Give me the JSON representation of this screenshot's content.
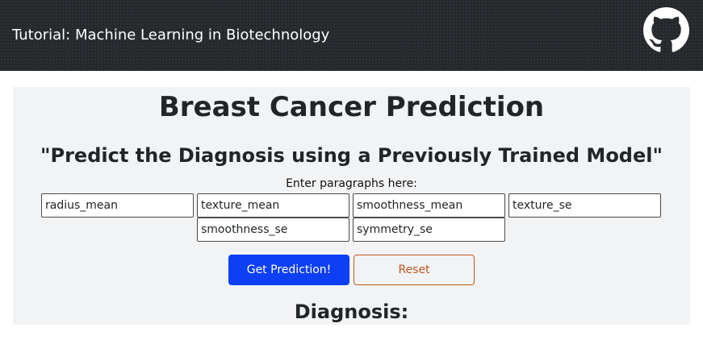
{
  "navbar": {
    "brand": "Tutorial: Machine Learning in Biotechnology",
    "github_icon": "github-icon",
    "bg_color": "#25282c"
  },
  "main": {
    "title": "Breast Cancer Prediction",
    "subtitle": "\"Predict the Diagnosis using a Previously Trained Model\"",
    "instruction": "Enter paragraphs here:",
    "fields": {
      "radius_mean": "radius_mean",
      "texture_mean": "texture_mean",
      "smoothness_mean": "smoothness_mean",
      "texture_se": "texture_se",
      "smoothness_se": "smoothness_se",
      "symmetry_se": "symmetry_se"
    },
    "predict_label": "Get Prediction!",
    "reset_label": "Reset",
    "diagnosis_label": "Diagnosis:"
  },
  "colors": {
    "primary": "#0d3ff5",
    "reset": "#b85a1f",
    "panel": "#f2f3f5"
  }
}
